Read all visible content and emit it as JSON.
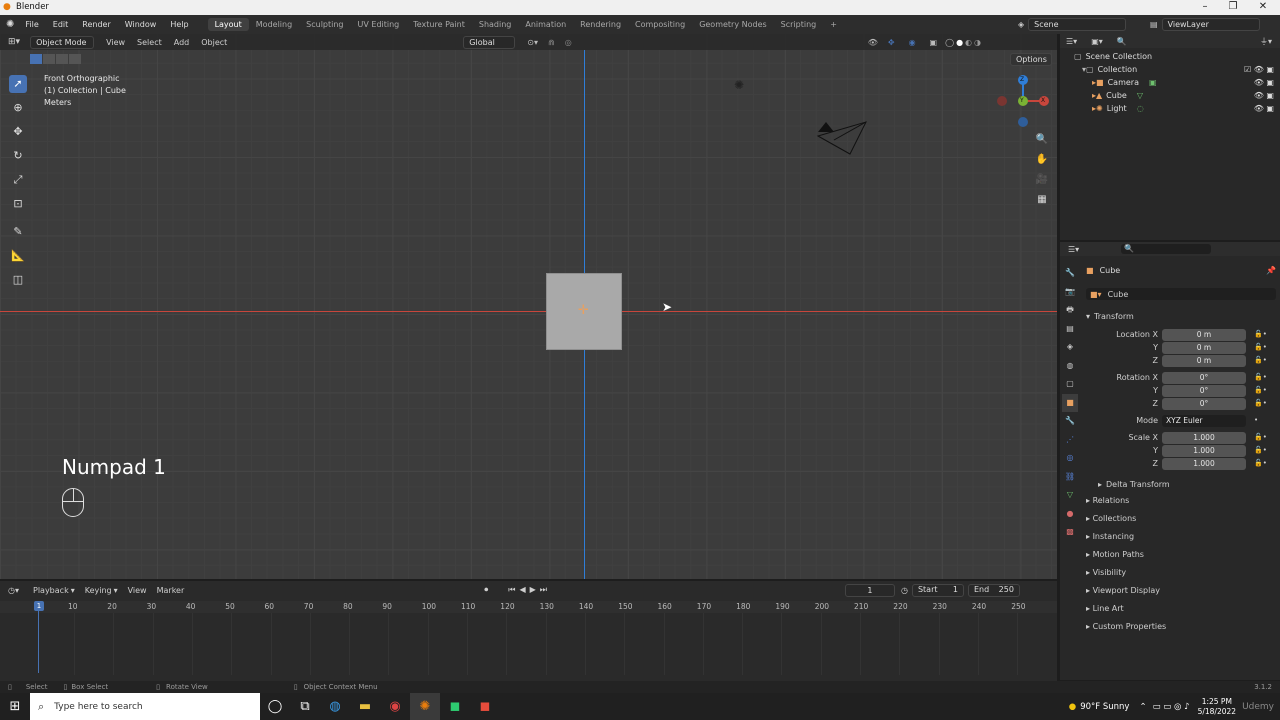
{
  "window": {
    "title": "Blender",
    "min": "–",
    "max": "❐",
    "close": "✕"
  },
  "menus": [
    "File",
    "Edit",
    "Render",
    "Window",
    "Help"
  ],
  "workspaces": [
    {
      "label": "Layout",
      "active": true
    },
    {
      "label": "Modeling"
    },
    {
      "label": "Sculpting"
    },
    {
      "label": "UV Editing"
    },
    {
      "label": "Texture Paint"
    },
    {
      "label": "Shading"
    },
    {
      "label": "Animation"
    },
    {
      "label": "Rendering"
    },
    {
      "label": "Compositing"
    },
    {
      "label": "Geometry Nodes"
    },
    {
      "label": "Scripting"
    }
  ],
  "add_workspace": "+",
  "scene": "Scene",
  "view_layer": "ViewLayer",
  "viewport_header": {
    "mode": "Object Mode",
    "menus": [
      "View",
      "Select",
      "Add",
      "Object"
    ],
    "orientation": "Global",
    "options": "Options"
  },
  "viewport": {
    "view_name": "Front Orthographic",
    "collection_info": "(1) Collection | Cube",
    "units": "Meters",
    "key_overlay": "Numpad 1",
    "gizmo": {
      "x": "X",
      "y": "Y",
      "z": "Z"
    }
  },
  "outliner": {
    "root": "Scene Collection",
    "collection": "Collection",
    "items": [
      {
        "label": "Camera",
        "icon": "camera-icon"
      },
      {
        "label": "Cube",
        "icon": "mesh-icon"
      },
      {
        "label": "Light",
        "icon": "light-icon"
      }
    ]
  },
  "properties": {
    "object_name": "Cube",
    "data_name": "Cube",
    "transform_label": "Transform",
    "location": {
      "label": "Location X",
      "x": "0 m",
      "y": "0 m",
      "z": "0 m"
    },
    "rotation": {
      "label": "Rotation X",
      "x": "0°",
      "y": "0°",
      "z": "0°"
    },
    "mode_label": "Mode",
    "mode_value": "XYZ Euler",
    "scale": {
      "label": "Scale X",
      "x": "1.000",
      "y": "1.000",
      "z": "1.000"
    },
    "axis_y": "Y",
    "axis_z": "Z",
    "delta": "Delta Transform",
    "panels": [
      "Relations",
      "Collections",
      "Instancing",
      "Motion Paths",
      "Visibility",
      "Viewport Display",
      "Line Art",
      "Custom Properties"
    ]
  },
  "timeline": {
    "menus": [
      "Playback",
      "Keying",
      "View",
      "Marker"
    ],
    "current_frame": "1",
    "start_label": "Start",
    "start": "1",
    "end_label": "End",
    "end": "250",
    "ruler": [
      "10",
      "20",
      "30",
      "40",
      "50",
      "60",
      "70",
      "80",
      "90",
      "100",
      "110",
      "120",
      "130",
      "140",
      "150",
      "160",
      "170",
      "180",
      "190",
      "200",
      "210",
      "220",
      "230",
      "240",
      "250"
    ],
    "playhead": "1"
  },
  "statusbar": {
    "select": "Select",
    "box_select": "Box Select",
    "rotate_view": "Rotate View",
    "context_menu": "Object Context Menu",
    "version": "3.1.2"
  },
  "taskbar": {
    "search_placeholder": "Type here to search",
    "weather": "90°F  Sunny",
    "time": "1:25 PM",
    "date": "5/18/2022",
    "watermark": "Udemy"
  },
  "colors": {
    "accent": "#4772b3",
    "x_axis": "#c8463c",
    "y_axis": "#7ab234",
    "z_axis": "#2f7ed8",
    "header": "#2d2d2d",
    "viewport": "#3c3c3c"
  }
}
